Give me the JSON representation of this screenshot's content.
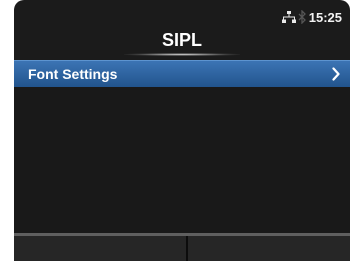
{
  "status": {
    "time": "15:25",
    "network_icon": "network-icon",
    "bluetooth_icon": "bluetooth-icon"
  },
  "header": {
    "title": "SIPL"
  },
  "menu": {
    "items": [
      {
        "label": "Font Settings",
        "icon": "chevron-right-icon"
      }
    ]
  },
  "colors": {
    "background": "#1b1b1b",
    "highlight": "#2a5f9e",
    "text": "#ffffff"
  }
}
